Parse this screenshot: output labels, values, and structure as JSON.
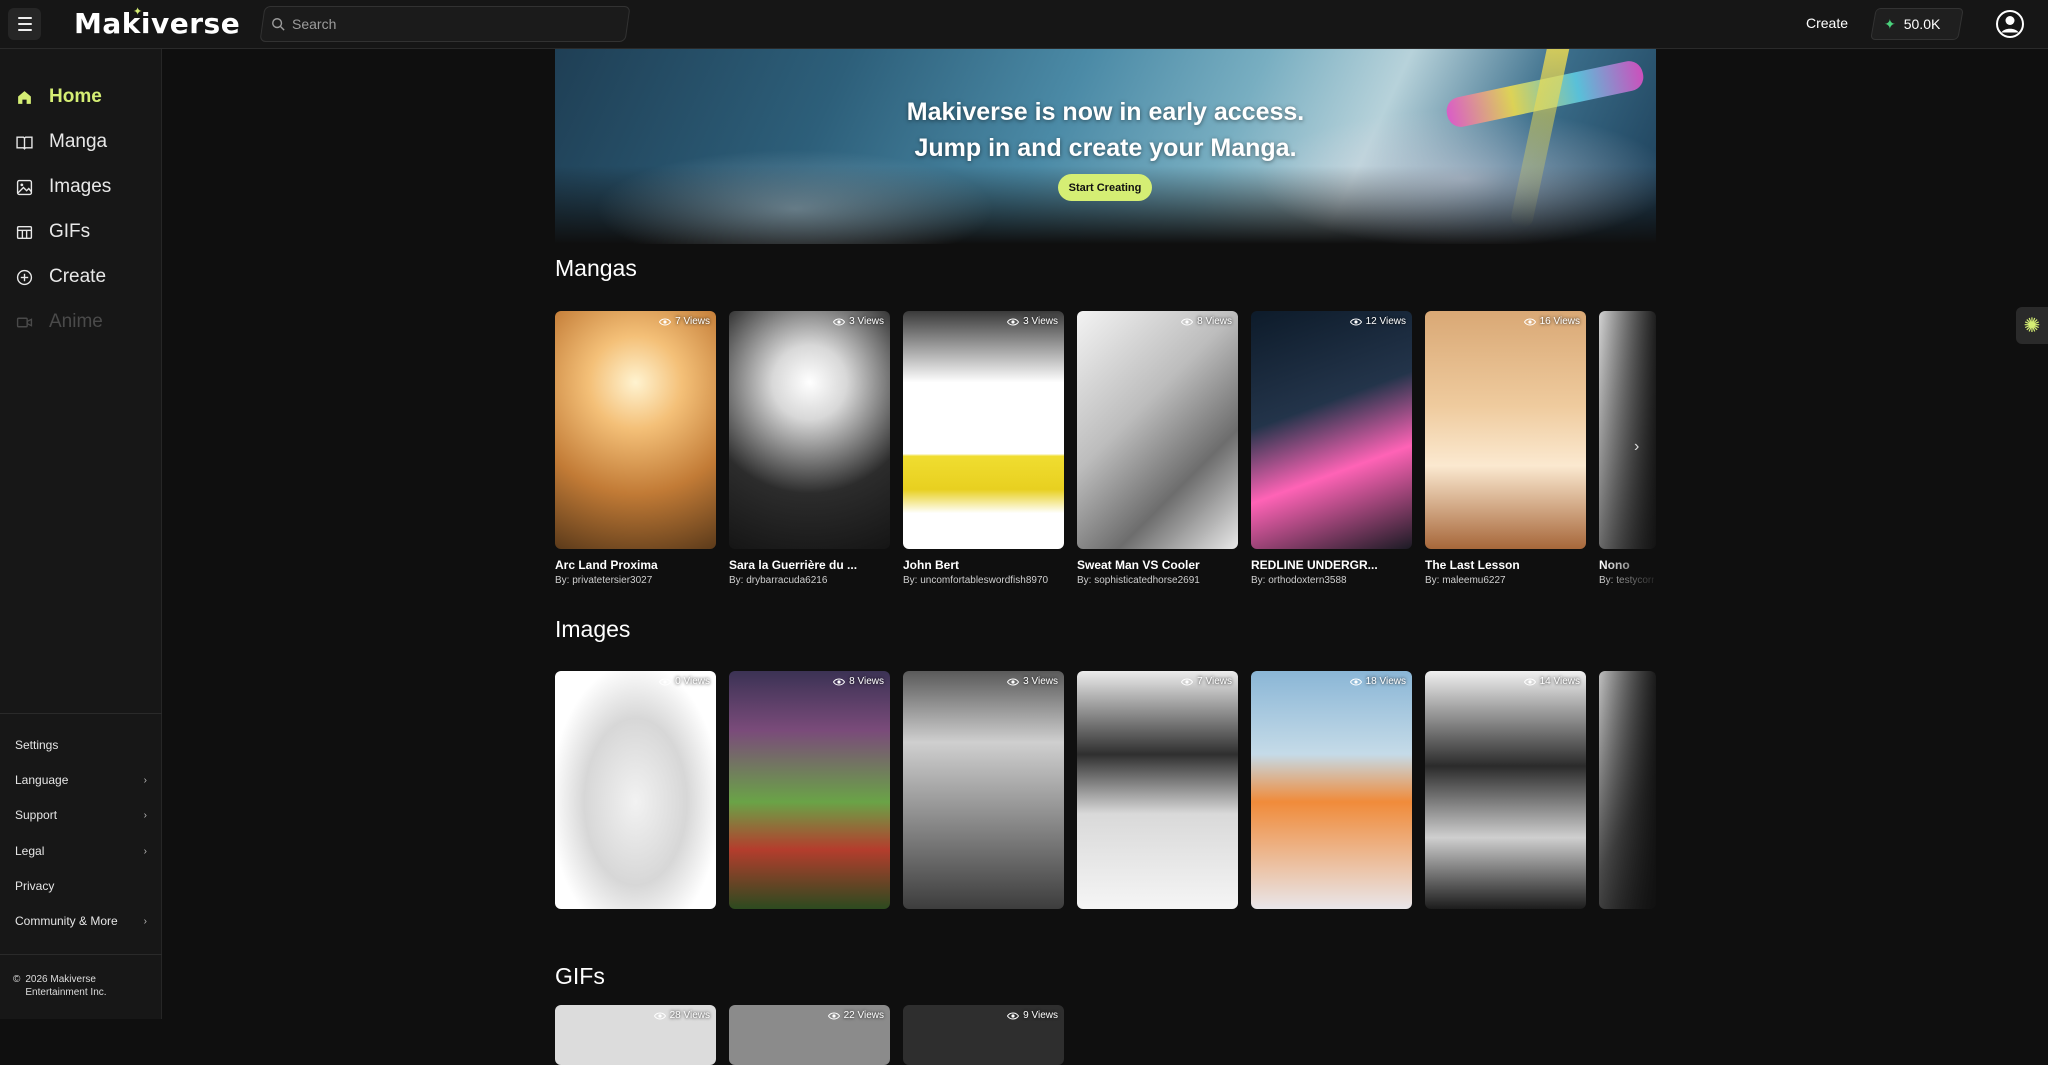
{
  "header": {
    "logo": "Makiverse",
    "search_placeholder": "Search",
    "create_label": "Create",
    "credits": "50.0K"
  },
  "sidebar": {
    "nav": [
      {
        "label": "Home",
        "icon": "home-icon",
        "active": true
      },
      {
        "label": "Manga",
        "icon": "book-icon"
      },
      {
        "label": "Images",
        "icon": "image-icon"
      },
      {
        "label": "GIFs",
        "icon": "film-icon"
      },
      {
        "label": "Create",
        "icon": "plus-circle-icon"
      },
      {
        "label": "Anime",
        "icon": "video-icon",
        "disabled": true
      }
    ],
    "footer_links": [
      {
        "label": "Settings",
        "chevron": false
      },
      {
        "label": "Language",
        "chevron": true
      },
      {
        "label": "Support",
        "chevron": true
      },
      {
        "label": "Legal",
        "chevron": true
      },
      {
        "label": "Privacy",
        "chevron": false
      },
      {
        "label": "Community & More",
        "chevron": true
      }
    ],
    "copyright_line1": "2026 Makiverse",
    "copyright_line2": "Entertainment Inc."
  },
  "hero": {
    "line1": "Makiverse is now in early access.",
    "line2": "Jump in and create your Manga.",
    "button": "Start Creating"
  },
  "sections": {
    "mangas_title": "Mangas",
    "images_title": "Images",
    "gifs_title": "GIFs"
  },
  "mangas": [
    {
      "title": "Arc Land Proxima",
      "author": "By: privatetersier3027",
      "views": "7 Views"
    },
    {
      "title": "Sara la Guerrière du ...",
      "author": "By: drybarracuda6216",
      "views": "3 Views"
    },
    {
      "title": "John Bert",
      "author": "By: uncomfortableswordfish8970",
      "views": "3 Views"
    },
    {
      "title": "Sweat Man VS Cooler",
      "author": "By: sophisticatedhorse2691",
      "views": "8 Views"
    },
    {
      "title": "REDLINE UNDERGR...",
      "author": "By: orthodoxtern3588",
      "views": "12 Views"
    },
    {
      "title": "The Last Lesson",
      "author": "By: maleemu6227",
      "views": "16 Views"
    },
    {
      "title": "Nono",
      "author": "By: testycorn",
      "views": ""
    }
  ],
  "images": [
    {
      "views": "0 Views"
    },
    {
      "views": "8 Views"
    },
    {
      "views": "3 Views"
    },
    {
      "views": "7 Views"
    },
    {
      "views": "18 Views"
    },
    {
      "views": "14 Views"
    },
    {
      "views": ""
    }
  ],
  "gifs": [
    {
      "views": "28 Views"
    },
    {
      "views": "22 Views"
    },
    {
      "views": "9 Views"
    }
  ],
  "colors": {
    "accent": "#d5ee74",
    "background": "#0f0f0f",
    "sidebar": "#171717",
    "credit_star": "#4ad27c"
  }
}
